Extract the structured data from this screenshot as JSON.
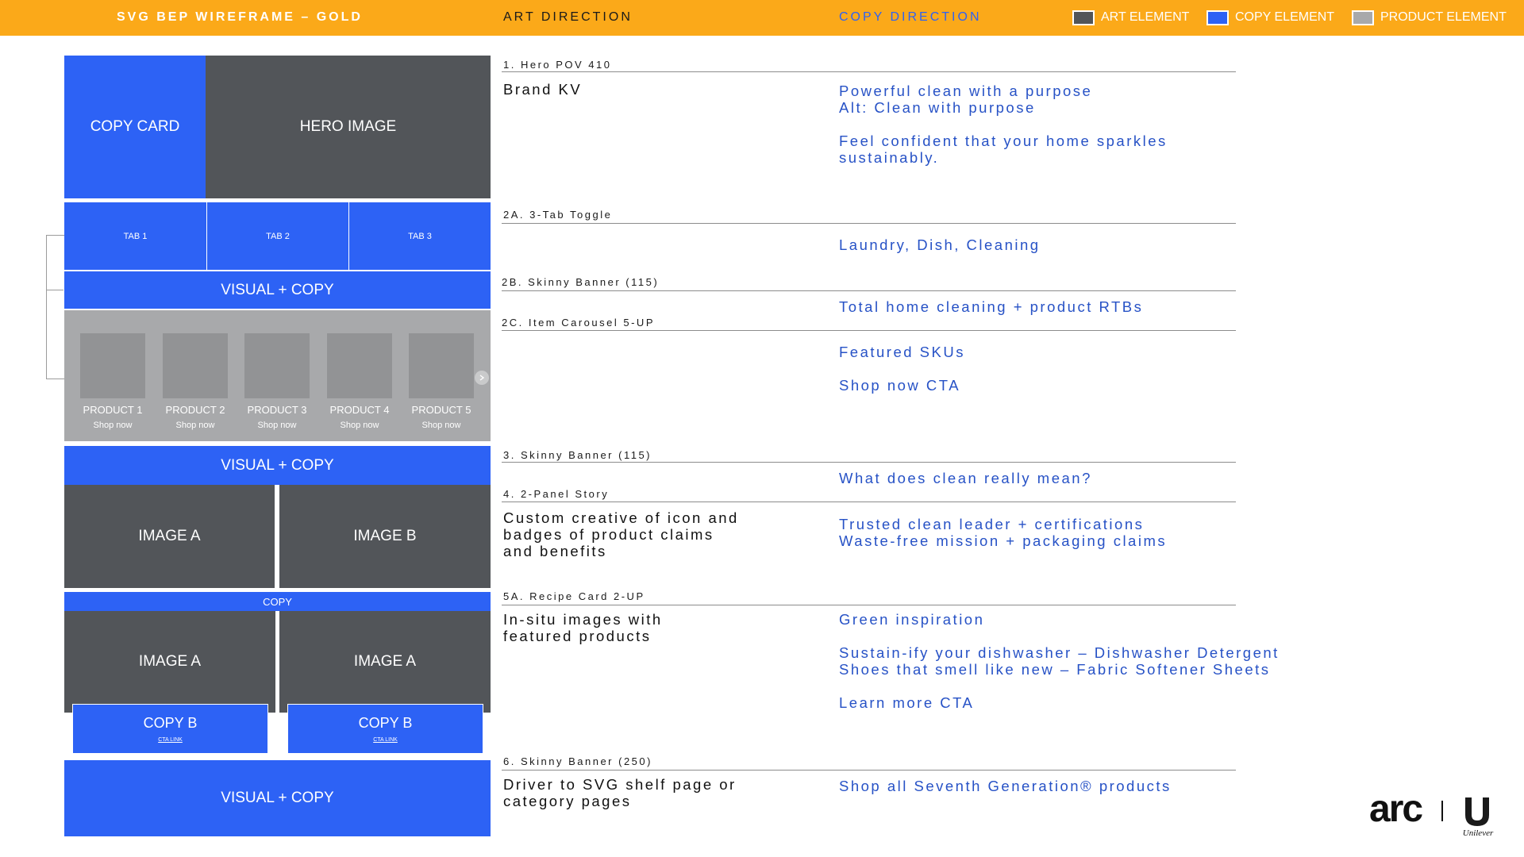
{
  "header": {
    "title": "SVG BEP WIREFRAME – GOLD",
    "art_direction": "ART DIRECTION",
    "copy_direction": "COPY DIRECTION",
    "legend": [
      {
        "label": "ART ELEMENT",
        "color": "#525559"
      },
      {
        "label": "COPY ELEMENT",
        "color": "#2D62F5"
      },
      {
        "label": "PRODUCT ELEMENT",
        "color": "#A8A9AB"
      }
    ]
  },
  "colors": {
    "header_bg": "#FBA919",
    "copy_blue": "#2D62F5",
    "art_dark": "#525559",
    "product_gray": "#A8A9AB",
    "copy_text": "#2752C6"
  },
  "wireframe": {
    "copy_card": "COPY CARD",
    "hero_image": "HERO IMAGE",
    "tabs": [
      "TAB 1",
      "TAB 2",
      "TAB 3"
    ],
    "visual_copy_1": "VISUAL + COPY",
    "products": [
      {
        "name": "PRODUCT 1",
        "cta": "Shop now"
      },
      {
        "name": "PRODUCT 2",
        "cta": "Shop now"
      },
      {
        "name": "PRODUCT 3",
        "cta": "Shop now"
      },
      {
        "name": "PRODUCT 4",
        "cta": "Shop now"
      },
      {
        "name": "PRODUCT 5",
        "cta": "Shop now"
      }
    ],
    "visual_copy_2": "VISUAL + COPY",
    "image_a": "IMAGE A",
    "image_b": "IMAGE B",
    "recipe_copy": "COPY",
    "recipe_image_1": "IMAGE A",
    "recipe_image_2": "IMAGE A",
    "copy_b_1": "COPY B",
    "copy_b_2": "COPY B",
    "cta_link_1": "CTA LINK",
    "cta_link_2": "CTA LINK",
    "visual_copy_3": "VISUAL + COPY"
  },
  "sections": [
    {
      "label": "1. Hero POV 410",
      "art": "Brand KV",
      "copy": "Powerful clean with a purpose\nAlt: Clean with purpose\n\nFeel confident that your home sparkles\nsustainably."
    },
    {
      "label": "2A. 3-Tab Toggle",
      "art": "",
      "copy": "Laundry, Dish, Cleaning"
    },
    {
      "label": "2B. Skinny Banner (115)",
      "art": "",
      "copy": "Total home cleaning + product RTBs"
    },
    {
      "label": "2C. Item Carousel 5-UP",
      "art": "",
      "copy": "Featured SKUs\n\nShop now CTA"
    },
    {
      "label": "3. Skinny Banner (115)",
      "art": "",
      "copy": "What does clean really mean?"
    },
    {
      "label": "4. 2-Panel Story",
      "art": "Custom creative of icon and\nbadges of product claims\nand benefits",
      "copy": "Trusted clean leader + certifications\nWaste-free mission + packaging claims"
    },
    {
      "label": "5A. Recipe Card 2-UP",
      "art": "In-situ images with\nfeatured products",
      "copy": "Green inspiration\n\nSustain-ify your dishwasher – Dishwasher Detergent\nShoes that smell like new – Fabric Softener Sheets\n\nLearn more CTA"
    },
    {
      "label": "6. Skinny Banner (250)",
      "art": "Driver to SVG shelf page or\ncategory pages",
      "copy": "Shop all Seventh Generation® products"
    }
  ],
  "logos": {
    "arc": "arc",
    "unilever": "Unilever"
  }
}
